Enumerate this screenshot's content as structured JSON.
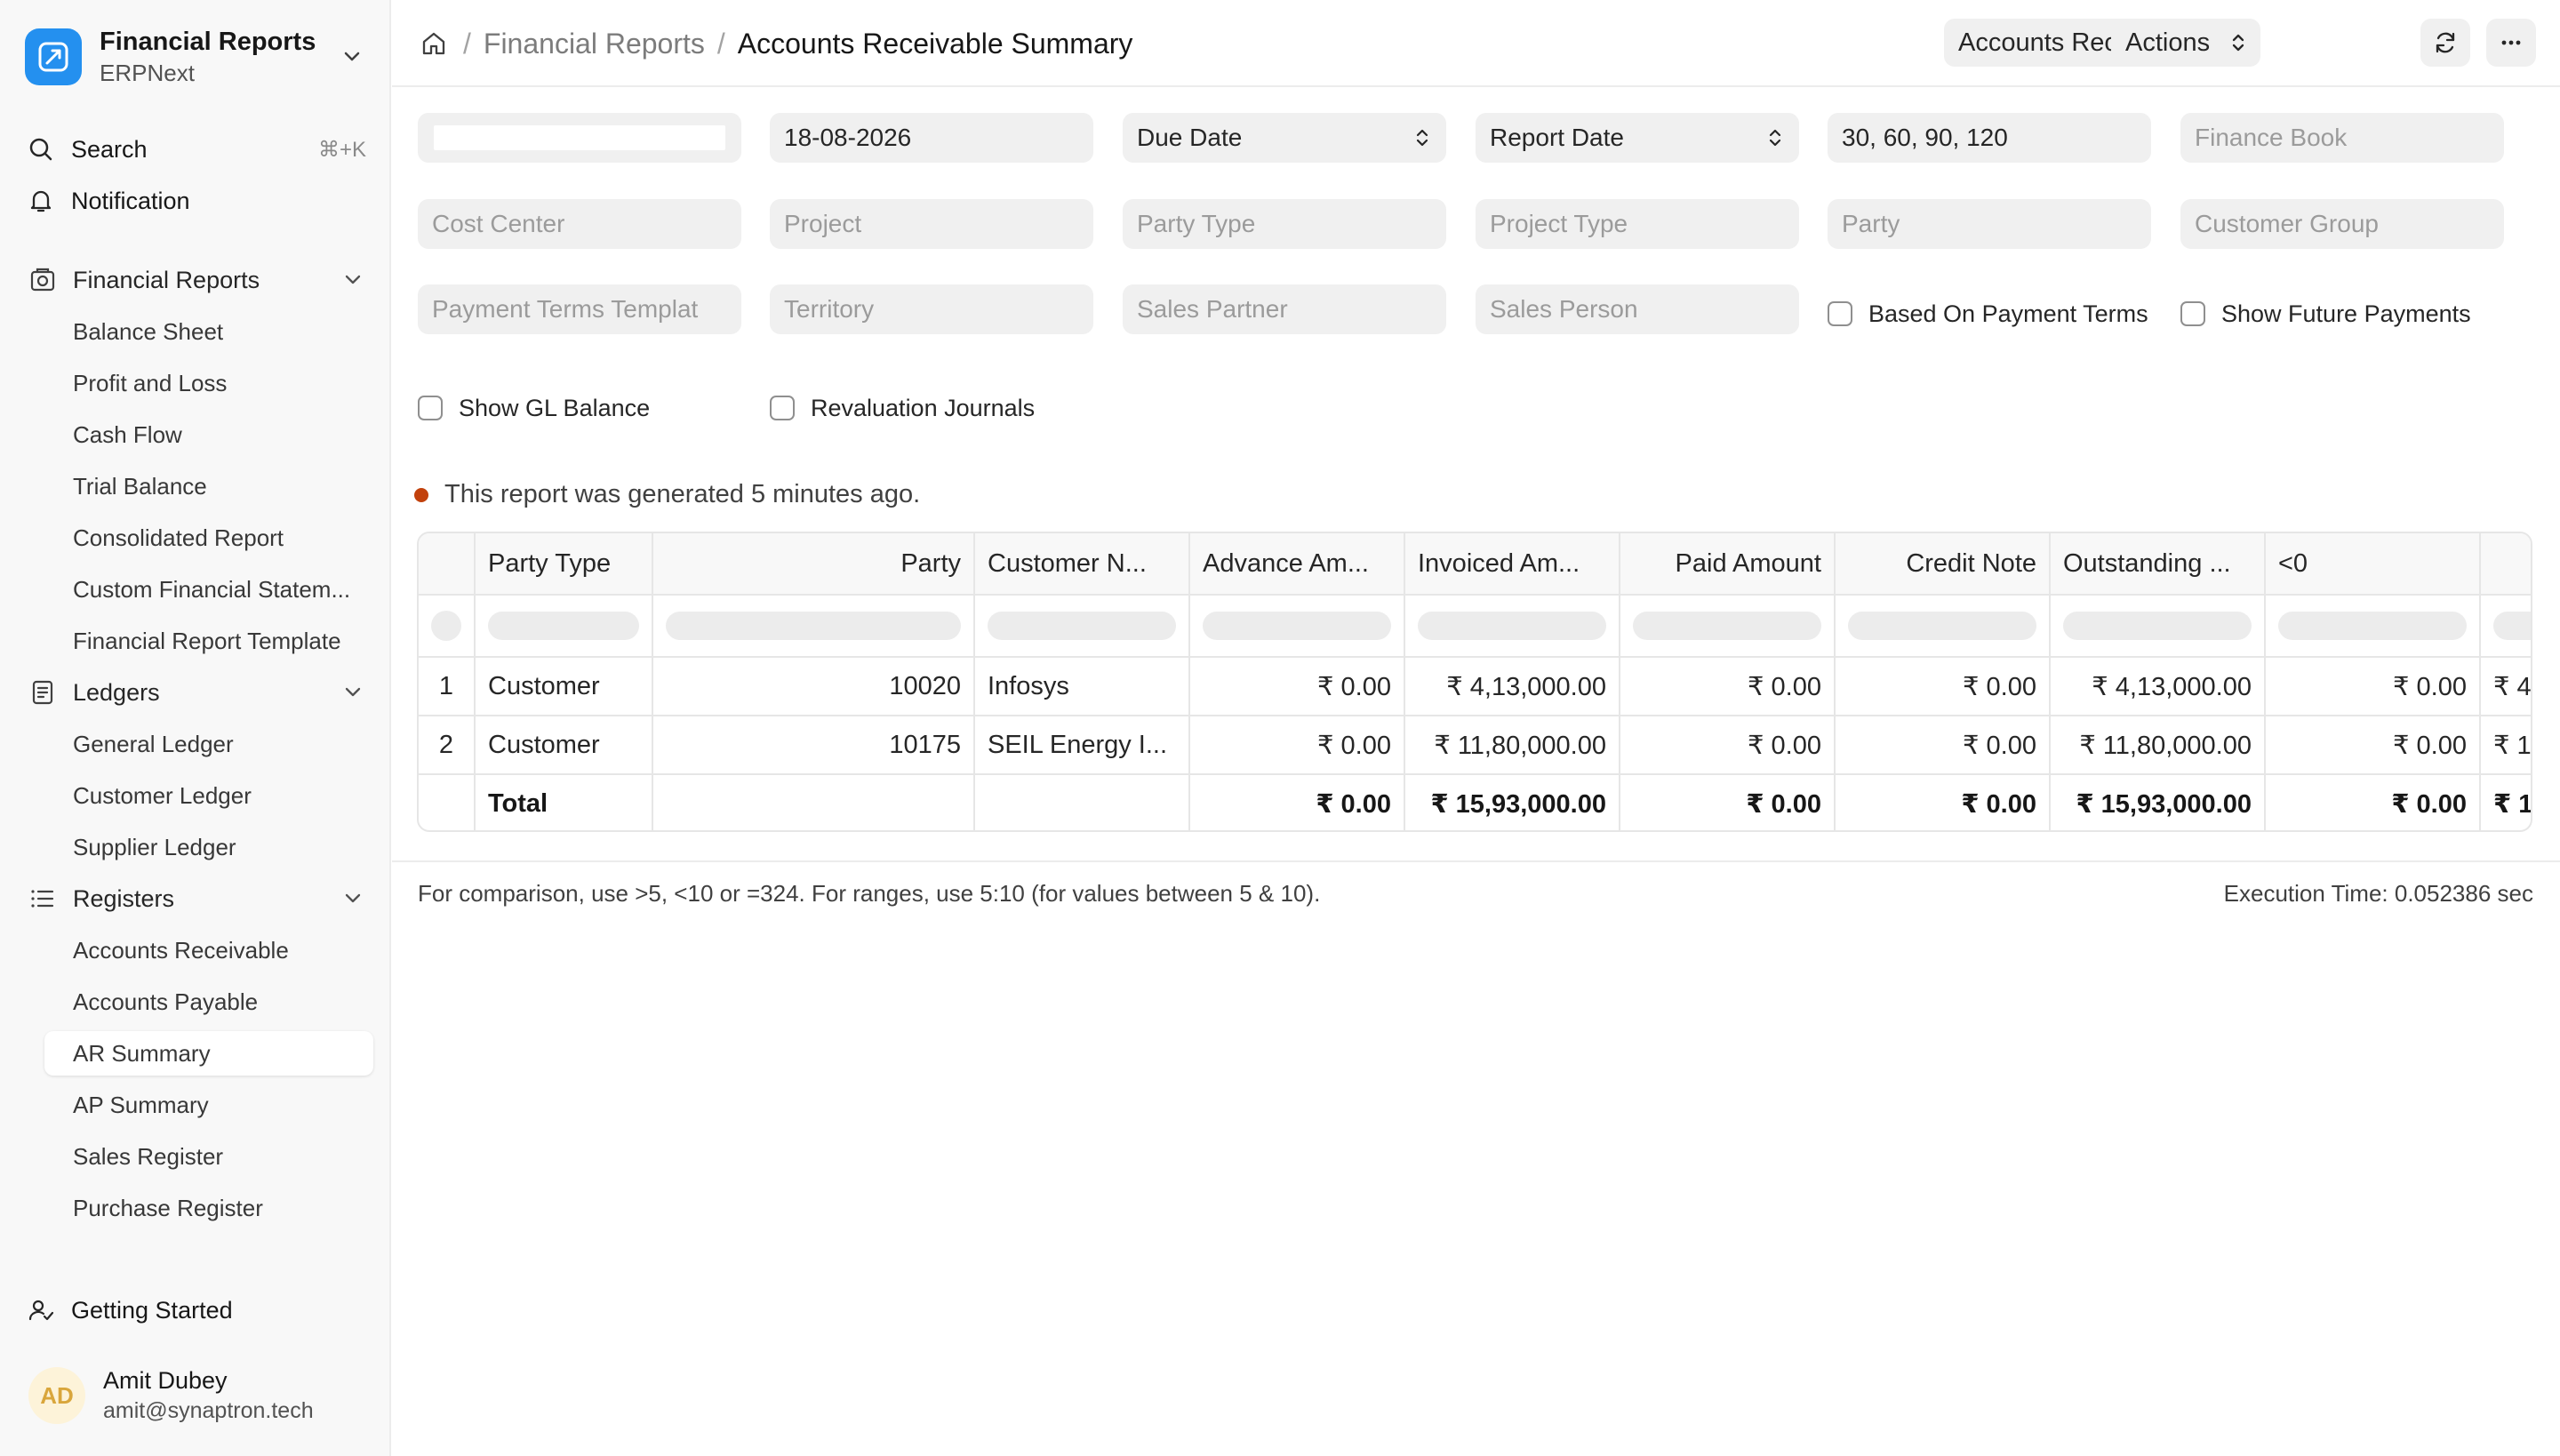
{
  "app": {
    "name": "Financial Reports",
    "subtitle": "ERPNext",
    "accent": "#2490ef"
  },
  "sidebar": {
    "search": {
      "label": "Search",
      "shortcut": "⌘+K"
    },
    "notification": {
      "label": "Notification"
    },
    "groups": [
      {
        "label": "Financial Reports",
        "icon": "report-icon",
        "items": [
          "Balance Sheet",
          "Profit and Loss",
          "Cash Flow",
          "Trial Balance",
          "Consolidated Report",
          "Custom Financial Statem...",
          "Financial Report Template"
        ]
      },
      {
        "label": "Ledgers",
        "icon": "ledger-icon",
        "items": [
          "General Ledger",
          "Customer Ledger",
          "Supplier Ledger"
        ]
      },
      {
        "label": "Registers",
        "icon": "list-icon",
        "items": [
          "Accounts Receivable",
          "Accounts Payable",
          "AR Summary",
          "AP Summary",
          "Sales Register",
          "Purchase Register"
        ]
      }
    ],
    "active_item": "AR Summary",
    "getting_started": "Getting Started",
    "user": {
      "initials": "AD",
      "name": "Amit Dubey",
      "email": "amit@synaptron.tech"
    }
  },
  "header": {
    "breadcrumb_parent": "Financial Reports",
    "breadcrumb_sep": "/",
    "title": "Accounts Receivable Summary",
    "report_switch": "Accounts Receivable",
    "actions_label": "Actions"
  },
  "filters": {
    "company": "",
    "date": "18-08-2026",
    "ageing_based_on": "Due Date",
    "calculate_ageing_with": "Report Date",
    "range": "30, 60, 90, 120",
    "finance_book": "Finance Book",
    "cost_center": "Cost Center",
    "project": "Project",
    "party_type": "Party Type",
    "project_type": "Project Type",
    "party": "Party",
    "customer_group": "Customer Group",
    "payment_terms_template": "Payment Terms Templat",
    "territory": "Territory",
    "sales_partner": "Sales Partner",
    "sales_person": "Sales Person",
    "based_on_payment_terms": {
      "label": "Based On Payment Terms",
      "checked": false
    },
    "show_future_payments": {
      "label": "Show Future Payments",
      "checked": false
    },
    "show_gl_balance": {
      "label": "Show GL Balance",
      "checked": false
    },
    "revaluation_journals": {
      "label": "Revaluation Journals",
      "checked": false
    }
  },
  "status": {
    "text": "This report was generated 5 minutes ago.",
    "color": "#c2410c"
  },
  "table": {
    "columns": [
      "Party Type",
      "Party",
      "Customer N...",
      "Advance Am...",
      "Invoiced Am...",
      "Paid Amount",
      "Credit Note",
      "Outstanding ...",
      "<0"
    ],
    "rows": [
      {
        "idx": "1",
        "party_type": "Customer",
        "party": "10020",
        "customer_name": "Infosys",
        "advance": "₹ 0.00",
        "invoiced": "₹ 4,13,000.00",
        "paid": "₹ 0.00",
        "credit_note": "₹ 0.00",
        "outstanding": "₹ 4,13,000.00",
        "lt0": "₹ 0.00",
        "next": "₹ 4"
      },
      {
        "idx": "2",
        "party_type": "Customer",
        "party": "10175",
        "customer_name": "SEIL Energy I...",
        "advance": "₹ 0.00",
        "invoiced": "₹ 11,80,000.00",
        "paid": "₹ 0.00",
        "credit_note": "₹ 0.00",
        "outstanding": "₹ 11,80,000.00",
        "lt0": "₹ 0.00",
        "next": "₹ 1"
      }
    ],
    "total": {
      "label": "Total",
      "advance": "₹ 0.00",
      "invoiced": "₹ 15,93,000.00",
      "paid": "₹ 0.00",
      "credit_note": "₹ 0.00",
      "outstanding": "₹ 15,93,000.00",
      "lt0": "₹ 0.00",
      "next": "₹ 1!"
    }
  },
  "footer": {
    "hint": "For comparison, use >5, <10 or =324. For ranges, use 5:10 (for values between 5 & 10).",
    "execution_time": "Execution Time: 0.052386 sec"
  }
}
